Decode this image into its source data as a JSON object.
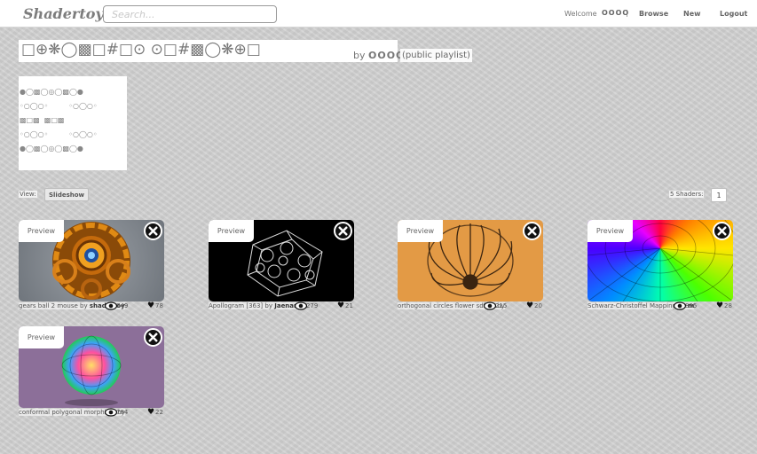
{
  "header": {
    "logo": "Shadertoy",
    "search_placeholder": "Search...",
    "welcome": "Welcome",
    "username": "OOOO",
    "separator": "|",
    "nav": [
      "Browse",
      "New",
      "Logout"
    ]
  },
  "playlist": {
    "title_glyphs": "□⊕❋◯▩□#□⊙  ⊙□#▩◯❋⊕□",
    "by_label": "by",
    "author": "OOOO",
    "visibility": "(public playlist)",
    "description": "●◯▩◯◎◯▩◯●\n◦○◯○◦         ◦○◯○◦\n▩□▩  ▩□▩\n◦○◯○◦         ◦○◯○◦\n●◯▩◯◎◯▩◯●"
  },
  "controls": {
    "view_label": "View:",
    "slideshow_label": "Slideshow",
    "shader_count": "5 Shaders:",
    "page": "1"
  },
  "colors": {
    "page_bg": "#cfcfcf",
    "header_bg": "#ffffff"
  },
  "shaders": [
    {
      "preview": "Preview",
      "name": "gears ball 2 mouse",
      "by": "by",
      "author": "shadertoy",
      "views": "749",
      "likes": "78",
      "thumb": "gears"
    },
    {
      "preview": "Preview",
      "name": "Apollogram [363]",
      "by": "by",
      "author": "Jaenam",
      "views": "279",
      "likes": "21",
      "thumb": "apollogram"
    },
    {
      "preview": "Preview",
      "name": "orthogonal circles flower sdf 2x",
      "by": "by",
      "author": "",
      "views": "215",
      "likes": "20",
      "thumb": "flower"
    },
    {
      "preview": "Preview",
      "name": "Schwarz-Christoffel Mapping",
      "by": "by",
      "author": "m",
      "views": "895",
      "likes": "28",
      "thumb": "schwarz"
    },
    {
      "preview": "Preview",
      "name": "conformal polygonal morphism",
      "by": "by",
      "author": "",
      "views": "784",
      "likes": "22",
      "thumb": "morph"
    }
  ]
}
